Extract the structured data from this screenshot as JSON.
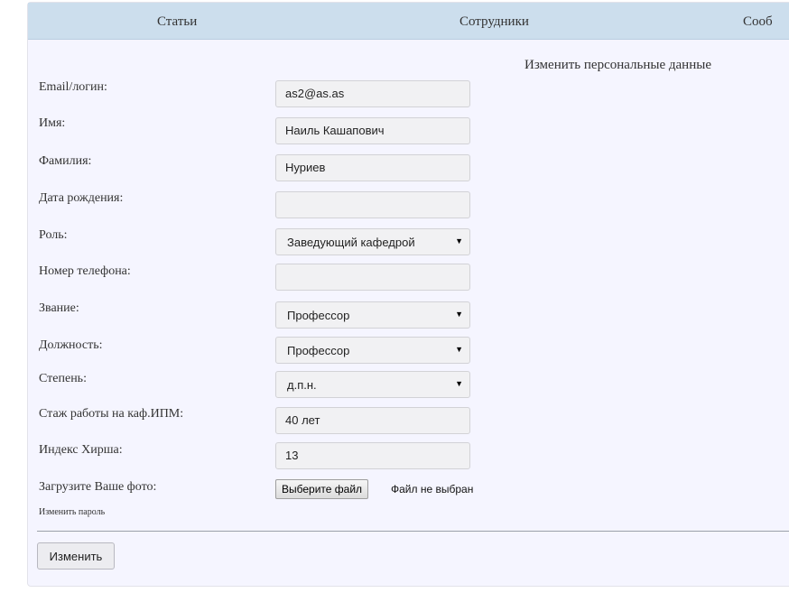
{
  "nav": {
    "items": [
      "Статьи",
      "Сотрудники",
      "Сооб"
    ]
  },
  "form": {
    "title": "Изменить персональные данные",
    "fields": [
      {
        "label": "Email/логин:",
        "value": "as2@as.as"
      },
      {
        "label": "Имя:",
        "value": "Наиль Кашапович"
      },
      {
        "label": "Фамилия:",
        "value": "Нуриев"
      },
      {
        "label": "Дата рождения:",
        "value": ""
      },
      {
        "label": "Роль:",
        "value": "Заведующий кафедрой"
      },
      {
        "label": "Номер телефона:",
        "value": ""
      },
      {
        "label": "Звание:",
        "value": "Профессор"
      },
      {
        "label": "Должность:",
        "value": "Профессор"
      },
      {
        "label": "Степень:",
        "value": "д.п.н."
      },
      {
        "label": "Стаж работы на каф.ИПМ:",
        "value": "40 лет"
      },
      {
        "label": "Индекс Хирша:",
        "value": "13"
      }
    ],
    "photo": {
      "label": "Загрузите Ваше фото:",
      "button": "Выберите файл",
      "status": "Файл не выбран"
    },
    "change_password": "Изменить пароль",
    "submit": "Изменить"
  }
}
